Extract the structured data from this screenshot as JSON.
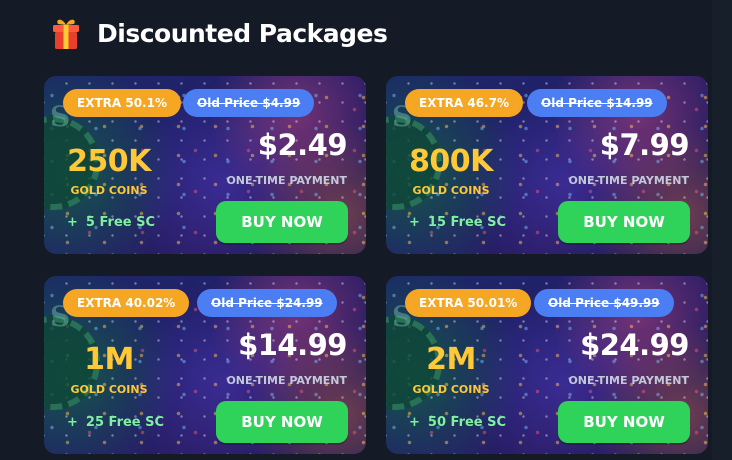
{
  "header": {
    "title": "Discounted Packages",
    "icon": "gift-icon"
  },
  "colors": {
    "background": "#141b26",
    "extra_badge": "#f5a623",
    "old_price_badge": "#4a7ef2",
    "coins_text": "#ffc837",
    "bonus_text": "#7ef0a0",
    "buy_button": "#2fd35a"
  },
  "packages": [
    {
      "extra": "EXTRA 50.1%",
      "old_price": "Old Price $4.99",
      "coins": "250K",
      "coins_label": "GOLD COINS",
      "bonus": "5 Free SC",
      "price": "$2.49",
      "payment_label": "ONE-TIME PAYMENT",
      "buy_label": "BUY NOW"
    },
    {
      "extra": "EXTRA 46.7%",
      "old_price": "Old Price $14.99",
      "coins": "800K",
      "coins_label": "GOLD COINS",
      "bonus": "15 Free SC",
      "price": "$7.99",
      "payment_label": "ONE-TIME PAYMENT",
      "buy_label": "BUY NOW"
    },
    {
      "extra": "EXTRA 40.02%",
      "old_price": "Old Price $24.99",
      "coins": "1M",
      "coins_label": "GOLD COINS",
      "bonus": "25 Free SC",
      "price": "$14.99",
      "payment_label": "ONE-TIME PAYMENT",
      "buy_label": "BUY NOW"
    },
    {
      "extra": "EXTRA 50.01%",
      "old_price": "Old Price $49.99",
      "coins": "2M",
      "coins_label": "GOLD COINS",
      "bonus": "50 Free SC",
      "price": "$24.99",
      "payment_label": "ONE-TIME PAYMENT",
      "buy_label": "BUY NOW"
    }
  ]
}
